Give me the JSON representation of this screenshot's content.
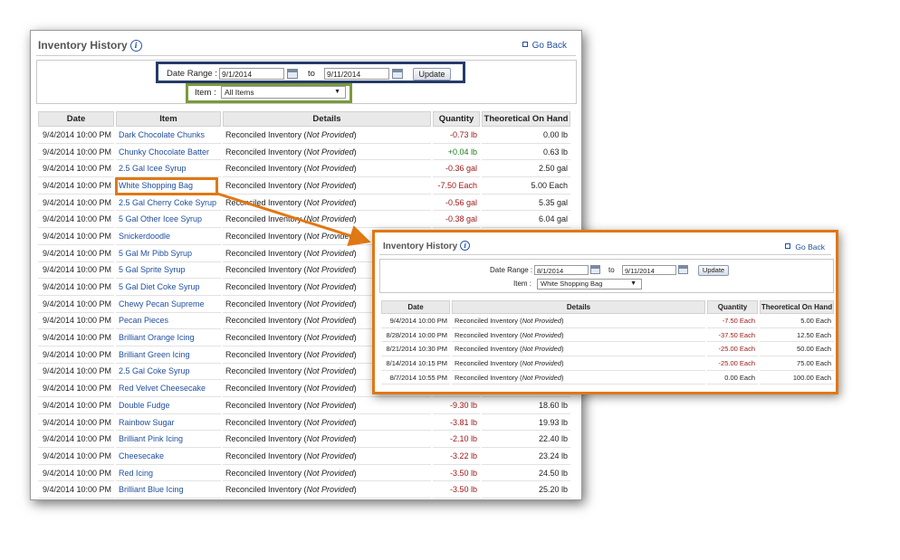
{
  "main": {
    "title": "Inventory History",
    "go_back": "Go Back",
    "date_range_label": "Date Range :",
    "date_from": "9/1/2014",
    "to_label": "to",
    "date_to": "9/11/2014",
    "update_label": "Update",
    "item_label": "Item :",
    "item_selected": "All Items",
    "columns": [
      "Date",
      "Item",
      "Details",
      "Quantity",
      "Theoretical On Hand"
    ],
    "rows": [
      {
        "date": "9/4/2014 10:00 PM",
        "item": "Dark Chocolate Chunks",
        "details": "Reconciled Inventory",
        "note": "Not Provided",
        "qty": "-0.73 lb",
        "onhand": "0.00 lb"
      },
      {
        "date": "9/4/2014 10:00 PM",
        "item": "Chunky Chocolate Batter",
        "details": "Reconciled Inventory",
        "note": "Not Provided",
        "qty": "+0.04 lb",
        "onhand": "0.63 lb"
      },
      {
        "date": "9/4/2014 10:00 PM",
        "item": "2.5 Gal Icee Syrup",
        "details": "Reconciled Inventory",
        "note": "Not Provided",
        "qty": "-0.36 gal",
        "onhand": "2.50 gal"
      },
      {
        "date": "9/4/2014 10:00 PM",
        "item": "White Shopping Bag",
        "details": "Reconciled Inventory",
        "note": "Not Provided",
        "qty": "-7.50 Each",
        "onhand": "5.00 Each"
      },
      {
        "date": "9/4/2014 10:00 PM",
        "item": "2.5 Gal Cherry Coke Syrup",
        "details": "Reconciled Inventory",
        "note": "Not Provided",
        "qty": "-0.56 gal",
        "onhand": "5.35 gal"
      },
      {
        "date": "9/4/2014 10:00 PM",
        "item": "5 Gal Other Icee Syrup",
        "details": "Reconciled Inventory",
        "note": "Not Provided",
        "qty": "-0.38 gal",
        "onhand": "6.04 gal"
      },
      {
        "date": "9/4/2014 10:00 PM",
        "item": "Snickerdoodle",
        "details": "Reconciled Inventory",
        "note": "Not Provided",
        "qty": "",
        "onhand": ""
      },
      {
        "date": "9/4/2014 10:00 PM",
        "item": "5 Gal Mr Pibb Syrup",
        "details": "Reconciled Inventory",
        "note": "Not Provided",
        "qty": "",
        "onhand": ""
      },
      {
        "date": "9/4/2014 10:00 PM",
        "item": "5 Gal Sprite Syrup",
        "details": "Reconciled Inventory",
        "note": "Not Provided",
        "qty": "",
        "onhand": ""
      },
      {
        "date": "9/4/2014 10:00 PM",
        "item": "5 Gal Diet Coke Syrup",
        "details": "Reconciled Inventory",
        "note": "Not Provided",
        "qty": "",
        "onhand": ""
      },
      {
        "date": "9/4/2014 10:00 PM",
        "item": "Chewy Pecan Supreme",
        "details": "Reconciled Inventory",
        "note": "Not Provided",
        "qty": "",
        "onhand": ""
      },
      {
        "date": "9/4/2014 10:00 PM",
        "item": "Pecan Pieces",
        "details": "Reconciled Inventory",
        "note": "Not Provided",
        "qty": "",
        "onhand": ""
      },
      {
        "date": "9/4/2014 10:00 PM",
        "item": "Brilliant Orange Icing",
        "details": "Reconciled Inventory",
        "note": "Not Provided",
        "qty": "",
        "onhand": ""
      },
      {
        "date": "9/4/2014 10:00 PM",
        "item": "Brilliant Green Icing",
        "details": "Reconciled Inventory",
        "note": "Not Provided",
        "qty": "",
        "onhand": ""
      },
      {
        "date": "9/4/2014 10:00 PM",
        "item": "2.5 Gal Coke Syrup",
        "details": "Reconciled Inventory",
        "note": "Not Provided",
        "qty": "",
        "onhand": ""
      },
      {
        "date": "9/4/2014 10:00 PM",
        "item": "Red Velvet Cheesecake",
        "details": "Reconciled Inventory",
        "note": "Not Provided",
        "qty": "",
        "onhand": ""
      },
      {
        "date": "9/4/2014 10:00 PM",
        "item": "Double Fudge",
        "details": "Reconciled Inventory",
        "note": "Not Provided",
        "qty": "-9.30 lb",
        "onhand": "18.60 lb"
      },
      {
        "date": "9/4/2014 10:00 PM",
        "item": "Rainbow Sugar",
        "details": "Reconciled Inventory",
        "note": "Not Provided",
        "qty": "-3.81 lb",
        "onhand": "19.93 lb"
      },
      {
        "date": "9/4/2014 10:00 PM",
        "item": "Brilliant Pink Icing",
        "details": "Reconciled Inventory",
        "note": "Not Provided",
        "qty": "-2.10 lb",
        "onhand": "22.40 lb"
      },
      {
        "date": "9/4/2014 10:00 PM",
        "item": "Cheesecake",
        "details": "Reconciled Inventory",
        "note": "Not Provided",
        "qty": "-3.22 lb",
        "onhand": "23.24 lb"
      },
      {
        "date": "9/4/2014 10:00 PM",
        "item": "Red Icing",
        "details": "Reconciled Inventory",
        "note": "Not Provided",
        "qty": "-3.50 lb",
        "onhand": "24.50 lb"
      },
      {
        "date": "9/4/2014 10:00 PM",
        "item": "Brilliant Blue Icing",
        "details": "Reconciled Inventory",
        "note": "Not Provided",
        "qty": "-3.50 lb",
        "onhand": "25.20 lb"
      }
    ]
  },
  "zoom": {
    "title": "Inventory History",
    "go_back": "Go Back",
    "date_range_label": "Date Range :",
    "date_from": "8/1/2014",
    "to_label": "to",
    "date_to": "9/11/2014",
    "update_label": "Update",
    "item_label": "Item :",
    "item_selected": "White Shopping Bag",
    "columns": [
      "Date",
      "Details",
      "Quantity",
      "Theoretical On Hand"
    ],
    "rows": [
      {
        "date": "9/4/2014 10:00 PM",
        "details": "Reconciled Inventory",
        "note": "Not Provided",
        "qty": "-7.50 Each",
        "onhand": "5.00 Each"
      },
      {
        "date": "8/28/2014 10:00 PM",
        "details": "Reconciled Inventory",
        "note": "Not Provided",
        "qty": "-37.50 Each",
        "onhand": "12.50 Each"
      },
      {
        "date": "8/21/2014 10:30 PM",
        "details": "Reconciled Inventory",
        "note": "Not Provided",
        "qty": "-25.00 Each",
        "onhand": "50.00 Each"
      },
      {
        "date": "8/14/2014 10:15 PM",
        "details": "Reconciled Inventory",
        "note": "Not Provided",
        "qty": "-25.00 Each",
        "onhand": "75.00 Each"
      },
      {
        "date": "8/7/2014 10:55 PM",
        "details": "Reconciled Inventory",
        "note": "Not Provided",
        "qty": "0.00 Each",
        "onhand": "100.00 Each"
      }
    ]
  },
  "colors": {
    "link": "#1f4e9e",
    "negative": "#a01818",
    "positive": "#1d7a1d",
    "highlight_date": "#253a6a",
    "highlight_item": "#7a9a3a",
    "highlight_callout": "#e07814"
  }
}
